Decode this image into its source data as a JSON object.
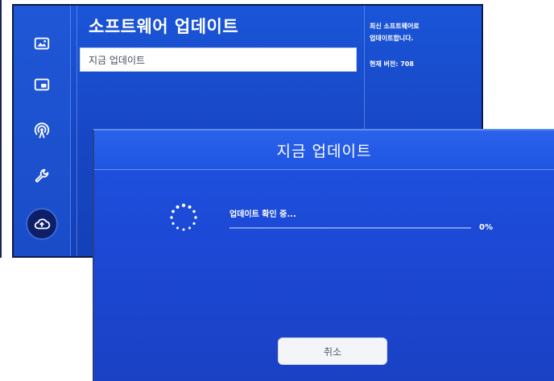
{
  "settings": {
    "title": "소프트웨어 업데이트",
    "selected_item": "지금 업데이트",
    "info_description": "최신 소프트웨어로\n업데이트합니다.",
    "current_version": "현재 버전: 708"
  },
  "sidebar": {
    "items": [
      {
        "icon": "picture-icon"
      },
      {
        "icon": "pip-icon"
      },
      {
        "icon": "broadcast-icon"
      },
      {
        "icon": "wrench-icon"
      },
      {
        "icon": "cloud-upload-icon",
        "active": true
      }
    ]
  },
  "dialog": {
    "title": "지금 업데이트",
    "status": "업데이트 확인 중...",
    "progress_percent": "0%",
    "progress_value": 0,
    "cancel_label": "취소"
  },
  "colors": {
    "screen_blue": "#1a4cc8",
    "dialog_blue": "#1c48d4",
    "active_icon_bg": "#0e1f6a",
    "button_bg": "#f4f5f8"
  }
}
